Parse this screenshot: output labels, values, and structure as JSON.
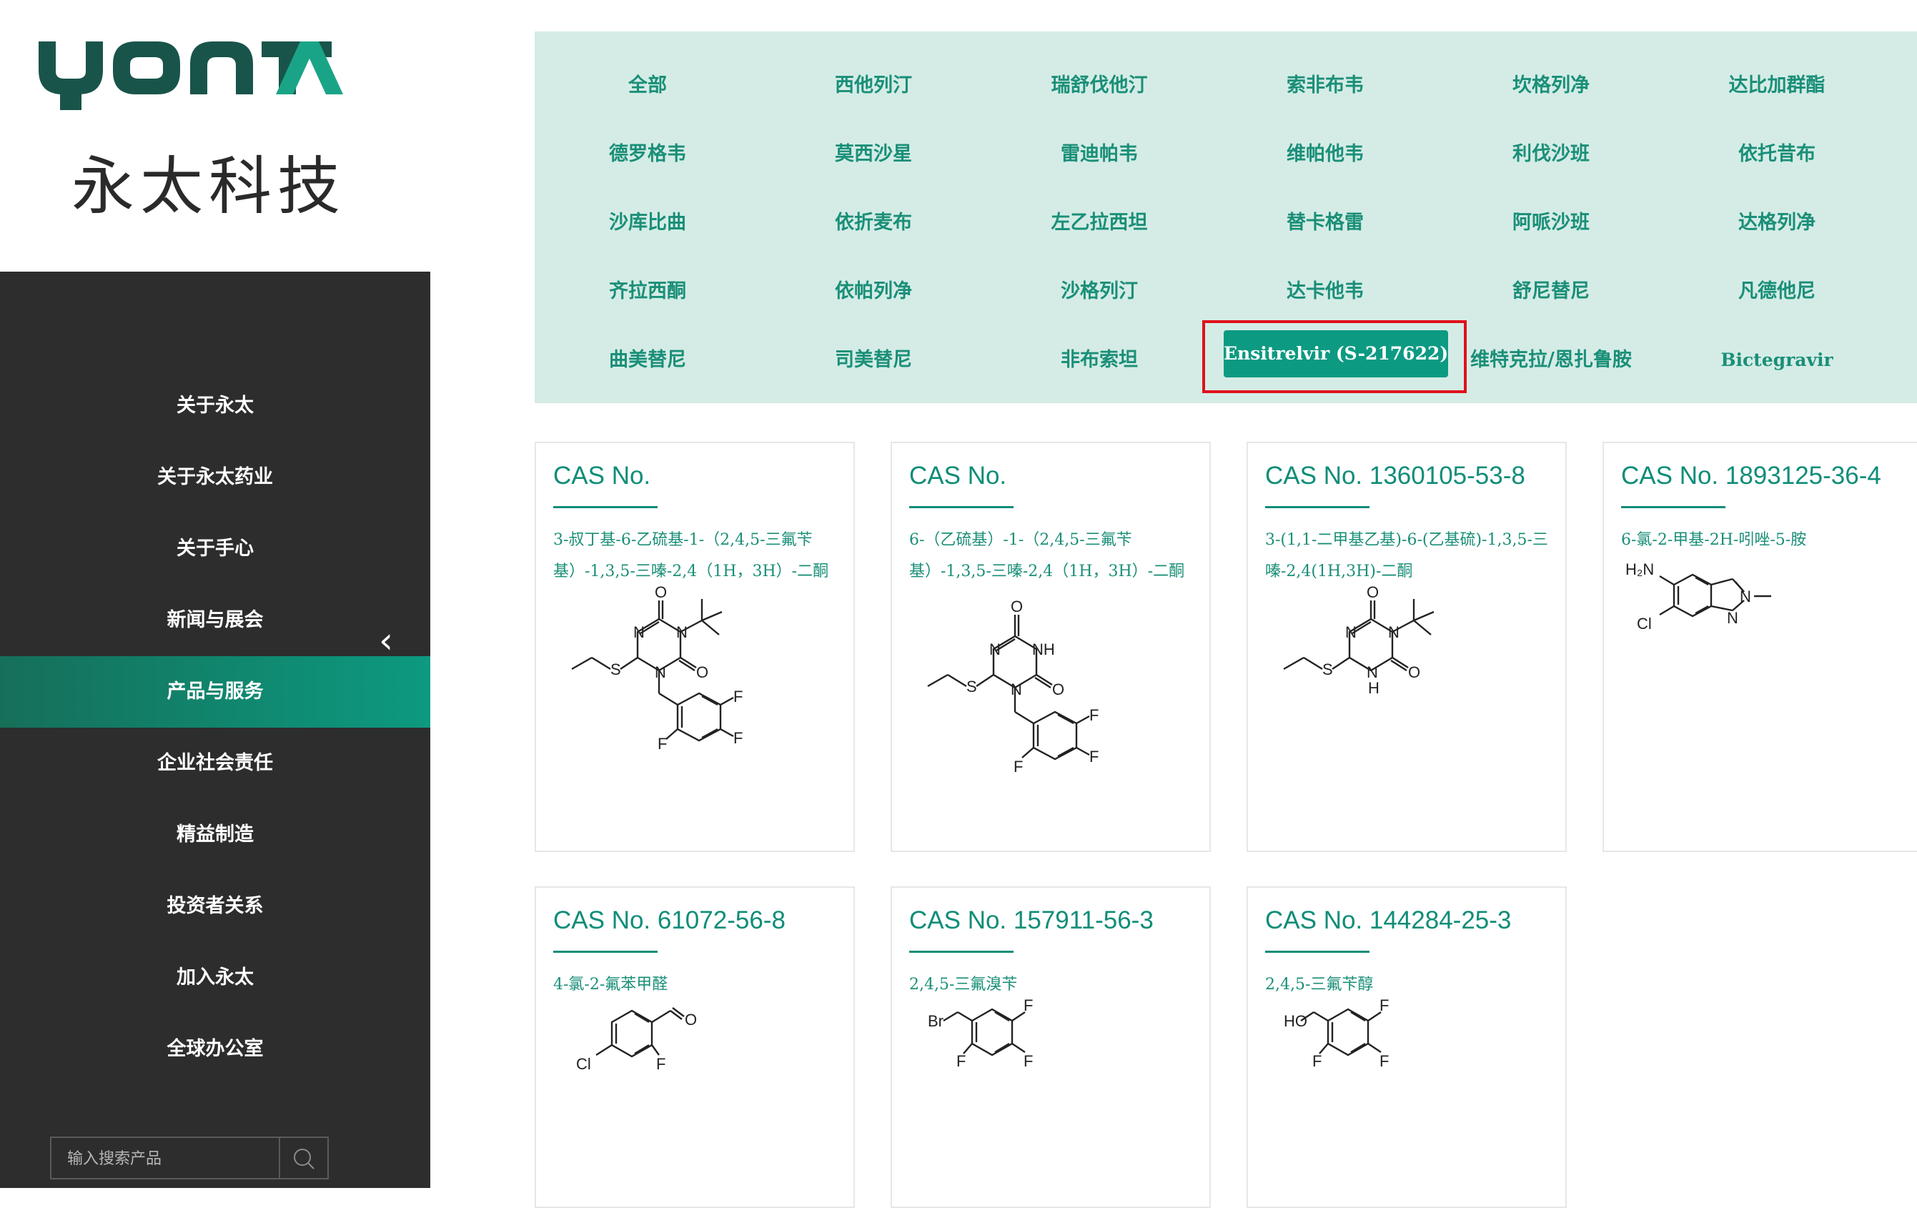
{
  "brand": {
    "logo_text": "YONTA",
    "name_cn": "永太科技"
  },
  "sidebar": {
    "items": [
      {
        "label": "关于永太"
      },
      {
        "label": "关于永太药业"
      },
      {
        "label": "关于手心"
      },
      {
        "label": "新闻与展会"
      },
      {
        "label": "产品与服务",
        "active": true
      },
      {
        "label": "企业社会责任"
      },
      {
        "label": "精益制造"
      },
      {
        "label": "投资者关系"
      },
      {
        "label": "加入永太"
      },
      {
        "label": "全球办公室"
      }
    ],
    "collapse_icon": "chevron-left-icon",
    "search_placeholder": "输入搜索产品",
    "search_icon": "search-icon"
  },
  "filters": [
    "全部",
    "西他列汀",
    "瑞舒伐他汀",
    "索非布韦",
    "坎格列净",
    "达比加群酯",
    "德罗格韦",
    "莫西沙星",
    "雷迪帕韦",
    "维帕他韦",
    "利伐沙班",
    "依托昔布",
    "沙库比曲",
    "依折麦布",
    "左乙拉西坦",
    "替卡格雷",
    "阿哌沙班",
    "达格列净",
    "齐拉西酮",
    "依帕列净",
    "沙格列汀",
    "达卡他韦",
    "舒尼替尼",
    "凡德他尼",
    "曲美替尼",
    "司美替尼",
    "非布索坦",
    "Ensitrelvir (S-217622)",
    "维特克拉/恩扎鲁胺",
    "Bictegravir"
  ],
  "active_filter": "Ensitrelvir (S-217622)",
  "products": [
    {
      "cas": "CAS No.",
      "name": "3-叔丁基-6-乙硫基-1-（2,4,5-三氟苄基）-1,3,5-三嗪-2,4（1H，3H）-二酮"
    },
    {
      "cas": "CAS No.",
      "name": "6-（乙硫基）-1-（2,4,5-三氟苄基）-1,3,5-三嗪-2,4（1H，3H）-二酮"
    },
    {
      "cas": "CAS No. 1360105-53-8",
      "name": "3-(1,1-二甲基乙基)-6-(乙基硫)-1,3,5-三嗪-2,4(1H,3H)-二酮"
    },
    {
      "cas": "CAS No. 1893125-36-4",
      "name": "6-氯-2-甲基-2H-吲唑-5-胺"
    },
    {
      "cas": "CAS No. 61072-56-8",
      "name": "4-氯-2-氟苯甲醛"
    },
    {
      "cas": "CAS No. 157911-56-3",
      "name": "2,4,5-三氟溴苄"
    },
    {
      "cas": "CAS No. 144284-25-3",
      "name": "2,4,5-三氟苄醇"
    }
  ],
  "atom_labels": {
    "O": "O",
    "N": "N",
    "NH": "NH",
    "H": "H",
    "S": "S",
    "F": "F",
    "Cl": "Cl",
    "Br": "Br",
    "HO": "HO",
    "H2N": "H₂N"
  },
  "colors": {
    "accent": "#0d9a82",
    "accent_text": "#1a8f78",
    "sidebar_bg": "#2d2d2d",
    "filter_bg": "#d5ece6",
    "highlight_border": "#e0101c"
  }
}
